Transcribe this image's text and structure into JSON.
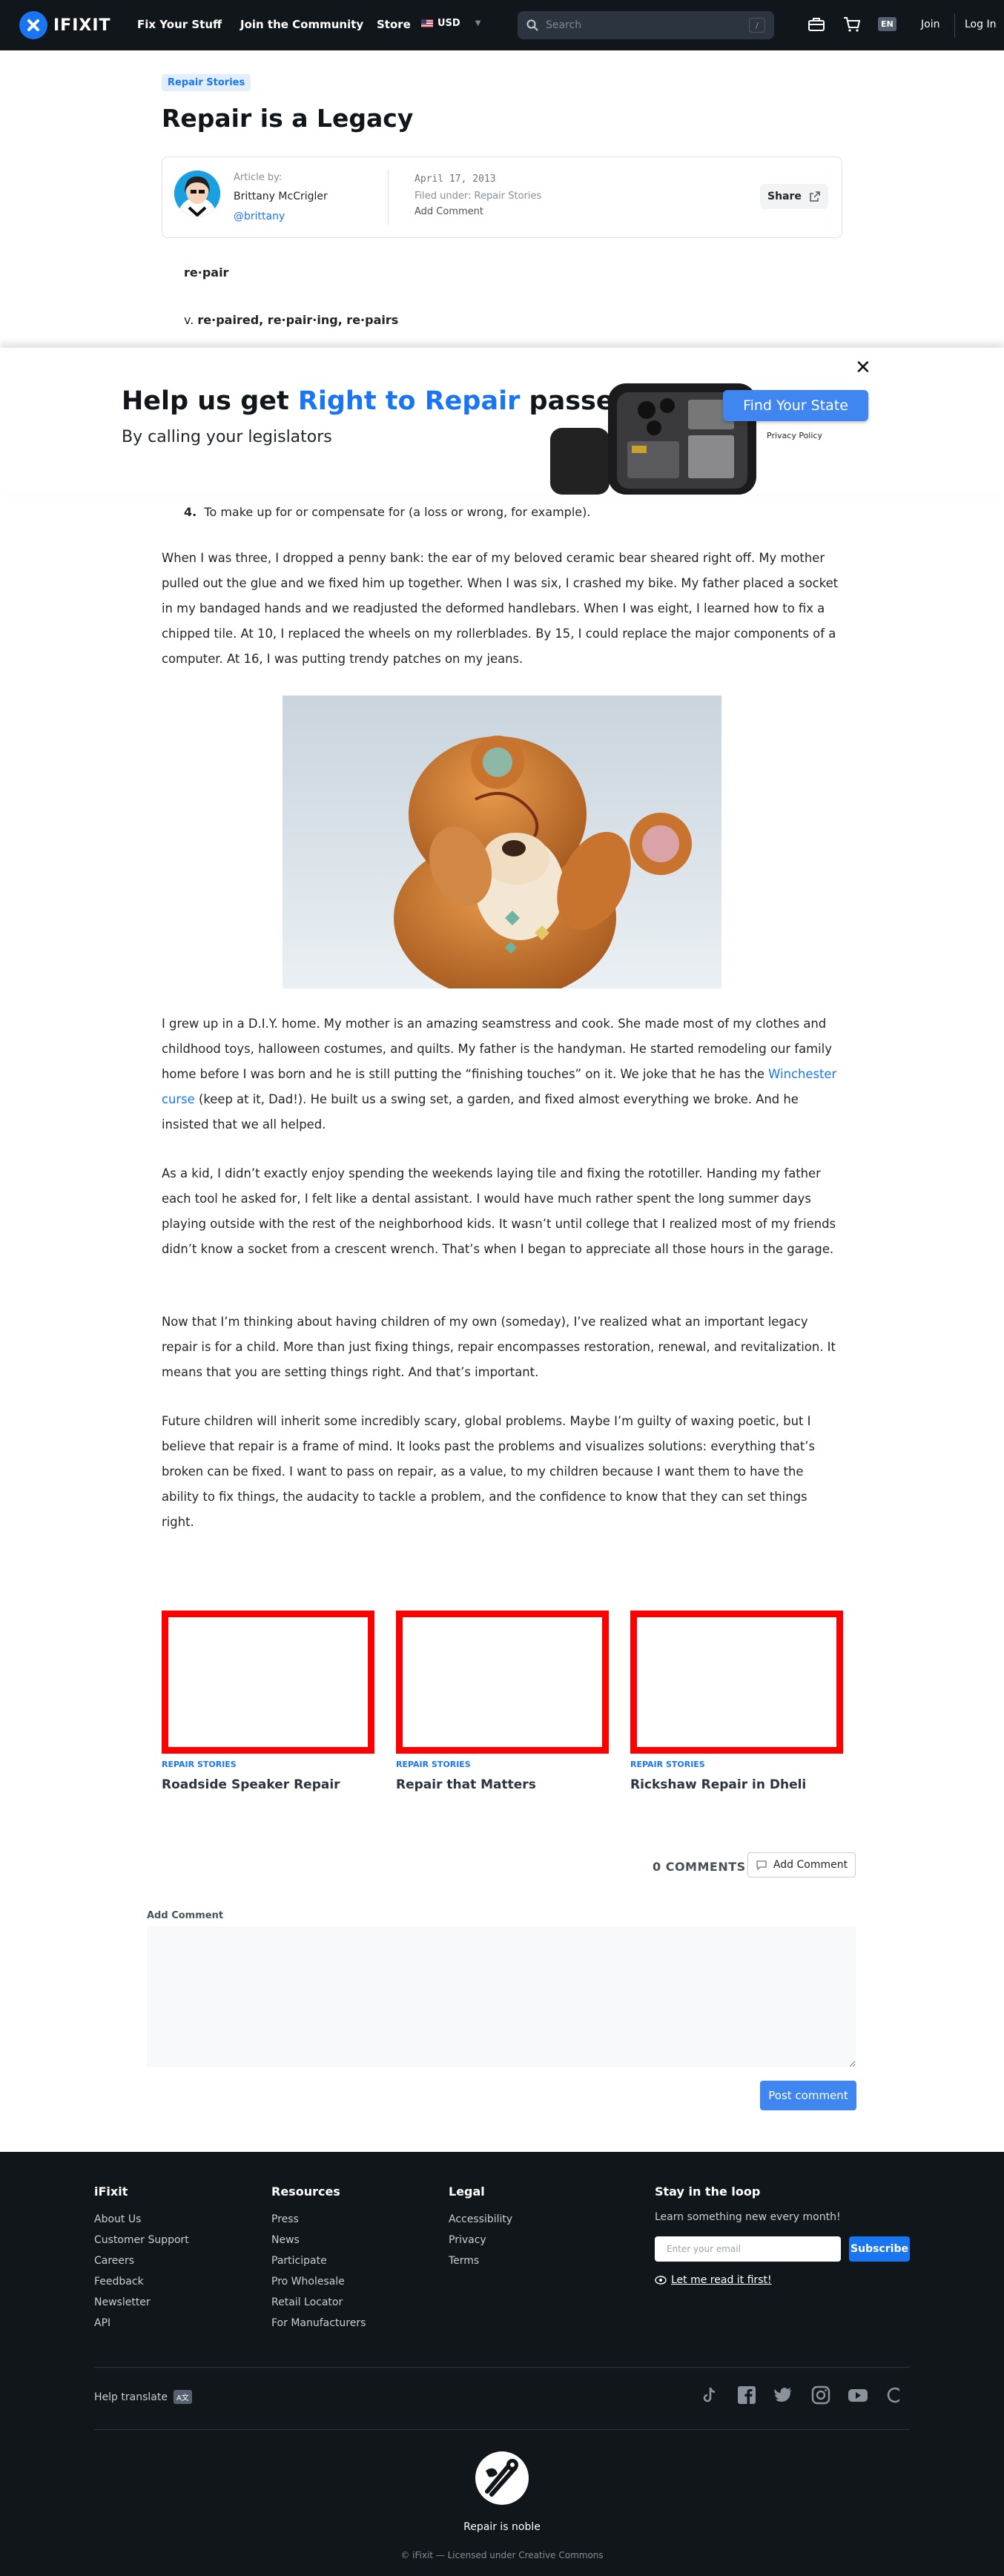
{
  "header": {
    "logo_text": "IFIXIT",
    "nav": [
      "Fix Your Stuff",
      "Join the Community",
      "Store"
    ],
    "currency": "USD",
    "search_placeholder": "Search",
    "search_shortcut": "/",
    "language": "EN",
    "join": "Join",
    "login": "Log In"
  },
  "article": {
    "tag": "Repair Stories",
    "title": "Repair is a Legacy",
    "by_label": "Article by:",
    "author": "Brittany McCrigler",
    "handle": "@brittany",
    "date": "April 17, 2013",
    "filed_label": "Filed under:",
    "filed_category": "Repair Stories",
    "add_comment": "Add Comment",
    "share": "Share",
    "def_word": "re·pair",
    "def_v_prefix": "v.",
    "def_v_forms": "re·paired, re·pair·ing, re·pairs",
    "item4_num": "4.",
    "item4_text": "To make up for or compensate for (a loss or wrong, for example).",
    "p1": "When I was three, I dropped a penny bank: the ear of my beloved ceramic bear sheared right off. My mother pulled out the glue and we fixed him up together. When I was six, I crashed my bike. My father placed a socket in my bandaged hands and we readjusted the deformed handlebars. When I was eight, I learned how to fix a chipped tile. At 10, I replaced the wheels on my rollerblades. By 15, I could replace the major components of a computer. At 16, I was putting trendy patches on my jeans.",
    "p2_before": "I grew up in a D.I.Y. home. My mother is an amazing seamstress and cook. She made most of my clothes and childhood toys, halloween costumes, and quilts. My father is the handyman. He started remodeling our family home before I was born and he is still putting the “finishing touches” on it. We joke that he has the ",
    "p2_link": "Winchester curse",
    "p2_after": " (keep at it, Dad!). He built us a swing set, a garden, and fixed almost everything we broke. And he insisted that we all helped.",
    "p3": "As a kid, I didn’t exactly enjoy spending the weekends laying tile and fixing the rototiller. Handing my father each tool he asked for, I felt like a dental assistant. I would have much rather spent the long summer days playing outside with the rest of the neighborhood kids. It wasn’t until college that I realized most of my friends didn’t know a socket from a crescent wrench. That’s when I began to appreciate all those hours in the garage.",
    "p4": "Now that I’m thinking about having children of my own (someday), I’ve realized what an important legacy repair is for a child. More than just fixing things, repair encompasses restoration, renewal, and revitalization. It means that you are setting things right. And that’s important.",
    "p5": "Future children will inherit some incredibly scary, global problems. Maybe I’m guilty of waxing poetic, but I believe that repair is a frame of mind. It looks past the problems and visualizes solutions: everything that’s broken can be fixed. I want to pass on repair, as a value, to my children because I want them to have the ability to fix things, the audacity to tackle a problem, and the confidence to know that they can set things right."
  },
  "banner": {
    "title_before": "Help us get ",
    "title_highlight": "Right to Repair",
    "title_after": " passed",
    "subtitle": "By calling your legislators",
    "cta": "Find Your State",
    "privacy": "Privacy Policy",
    "close": "✕"
  },
  "related": [
    {
      "tag": "REPAIR STORIES",
      "title": "Roadside Speaker Repair"
    },
    {
      "tag": "REPAIR STORIES",
      "title": "Repair that Matters"
    },
    {
      "tag": "REPAIR STORIES",
      "title": "Rickshaw Repair in Dheli"
    }
  ],
  "comments": {
    "count_label": "0 COMMENTS",
    "add_button": "Add Comment",
    "form_label": "Add Comment",
    "post": "Post comment"
  },
  "footer": {
    "col1": {
      "heading": "iFixit",
      "links": [
        "About Us",
        "Customer Support",
        "Careers",
        "Feedback",
        "Newsletter",
        "API"
      ]
    },
    "col2": {
      "heading": "Resources",
      "links": [
        "Press",
        "News",
        "Participate",
        "Pro Wholesale",
        "Retail Locator",
        "For Manufacturers"
      ]
    },
    "col3": {
      "heading": "Legal",
      "links": [
        "Accessibility",
        "Privacy",
        "Terms"
      ]
    },
    "loop": {
      "heading": "Stay in the loop",
      "desc": "Learn something new every month!",
      "email_placeholder": "Enter your email",
      "subscribe": "Subscribe",
      "read_first": "Let me read it first!"
    },
    "help_translate": "Help translate",
    "translate_icon": "A文",
    "social_icons": [
      "tiktok-icon",
      "facebook-icon",
      "twitter-icon",
      "instagram-icon",
      "youtube-icon",
      "threads-icon"
    ],
    "tagline": "Repair is noble",
    "license": "© iFixit — Licensed under Creative Commons"
  },
  "colors": {
    "accent": "#1975f1",
    "header_bg": "#11161a",
    "card_border": "#ff0000",
    "cta": "#3f86f0"
  }
}
